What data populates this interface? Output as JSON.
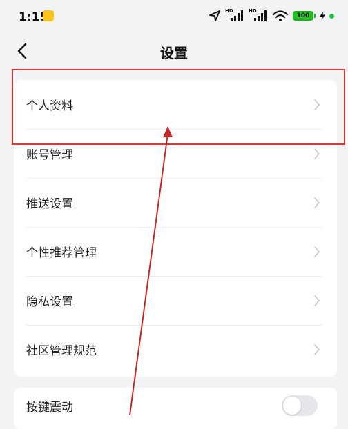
{
  "status_bar": {
    "time": "1:15",
    "hd_1": "HD",
    "hd_2": "HD",
    "battery": "100",
    "battery_color": "#24c224"
  },
  "navbar": {
    "back_icon": "chevron-left-icon",
    "title": "设置"
  },
  "settings": {
    "items": [
      {
        "label": "个人资料",
        "icon": "chevron-right-icon"
      },
      {
        "label": "账号管理",
        "icon": "chevron-right-icon"
      },
      {
        "label": "推送设置",
        "icon": "chevron-right-icon"
      },
      {
        "label": "个性推荐管理",
        "icon": "chevron-right-icon"
      },
      {
        "label": "隐私设置",
        "icon": "chevron-right-icon"
      },
      {
        "label": "社区管理规范",
        "icon": "chevron-right-icon"
      }
    ],
    "toggle_label": "按键震动",
    "toggle_on": false
  },
  "annotation": {
    "color": "#e03434"
  }
}
